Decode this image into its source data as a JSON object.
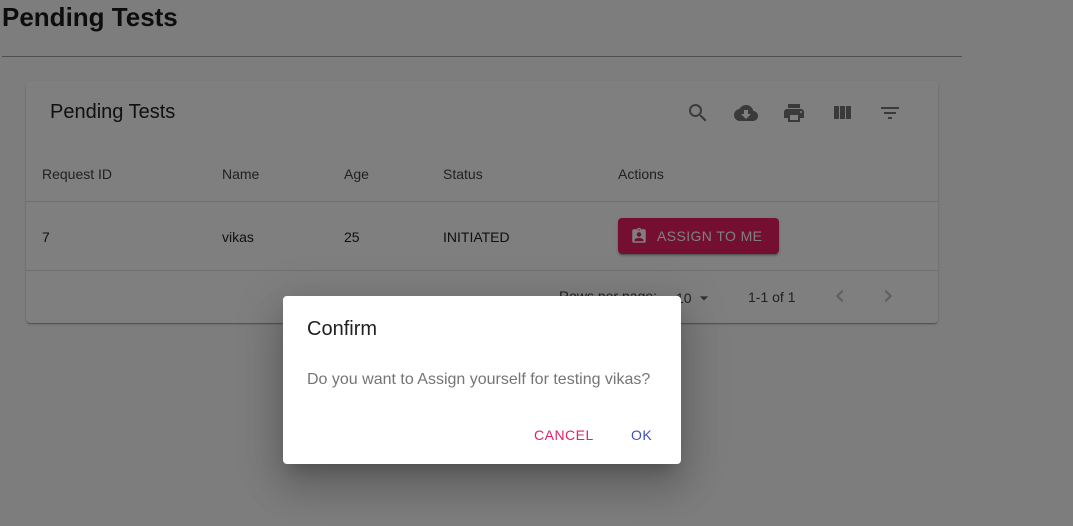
{
  "page": {
    "title": "Pending Tests"
  },
  "table": {
    "title": "Pending Tests",
    "toolbar": [
      {
        "name": "search-icon"
      },
      {
        "name": "download-icon"
      },
      {
        "name": "print-icon"
      },
      {
        "name": "view-columns-icon"
      },
      {
        "name": "filter-icon"
      }
    ],
    "columns": [
      "Request ID",
      "Name",
      "Age",
      "Status",
      "Actions"
    ],
    "rows": [
      {
        "request_id": "7",
        "name": "vikas",
        "age": "25",
        "status": "INITIATED",
        "action_label": "ASSIGN TO ME",
        "action_icon": "assignment-ind-icon"
      }
    ],
    "pagination": {
      "rows_per_page_label": "Rows per page:",
      "rows_per_page_value": "10",
      "range": "1-1 of 1"
    }
  },
  "dialog": {
    "title": "Confirm",
    "message": "Do you want to Assign yourself for testing vikas?",
    "cancel_label": "CANCEL",
    "ok_label": "OK"
  },
  "colors": {
    "primary": "#3f51b5",
    "secondary": "#e91e63",
    "backdrop": "rgba(0,0,0,0.5)"
  }
}
